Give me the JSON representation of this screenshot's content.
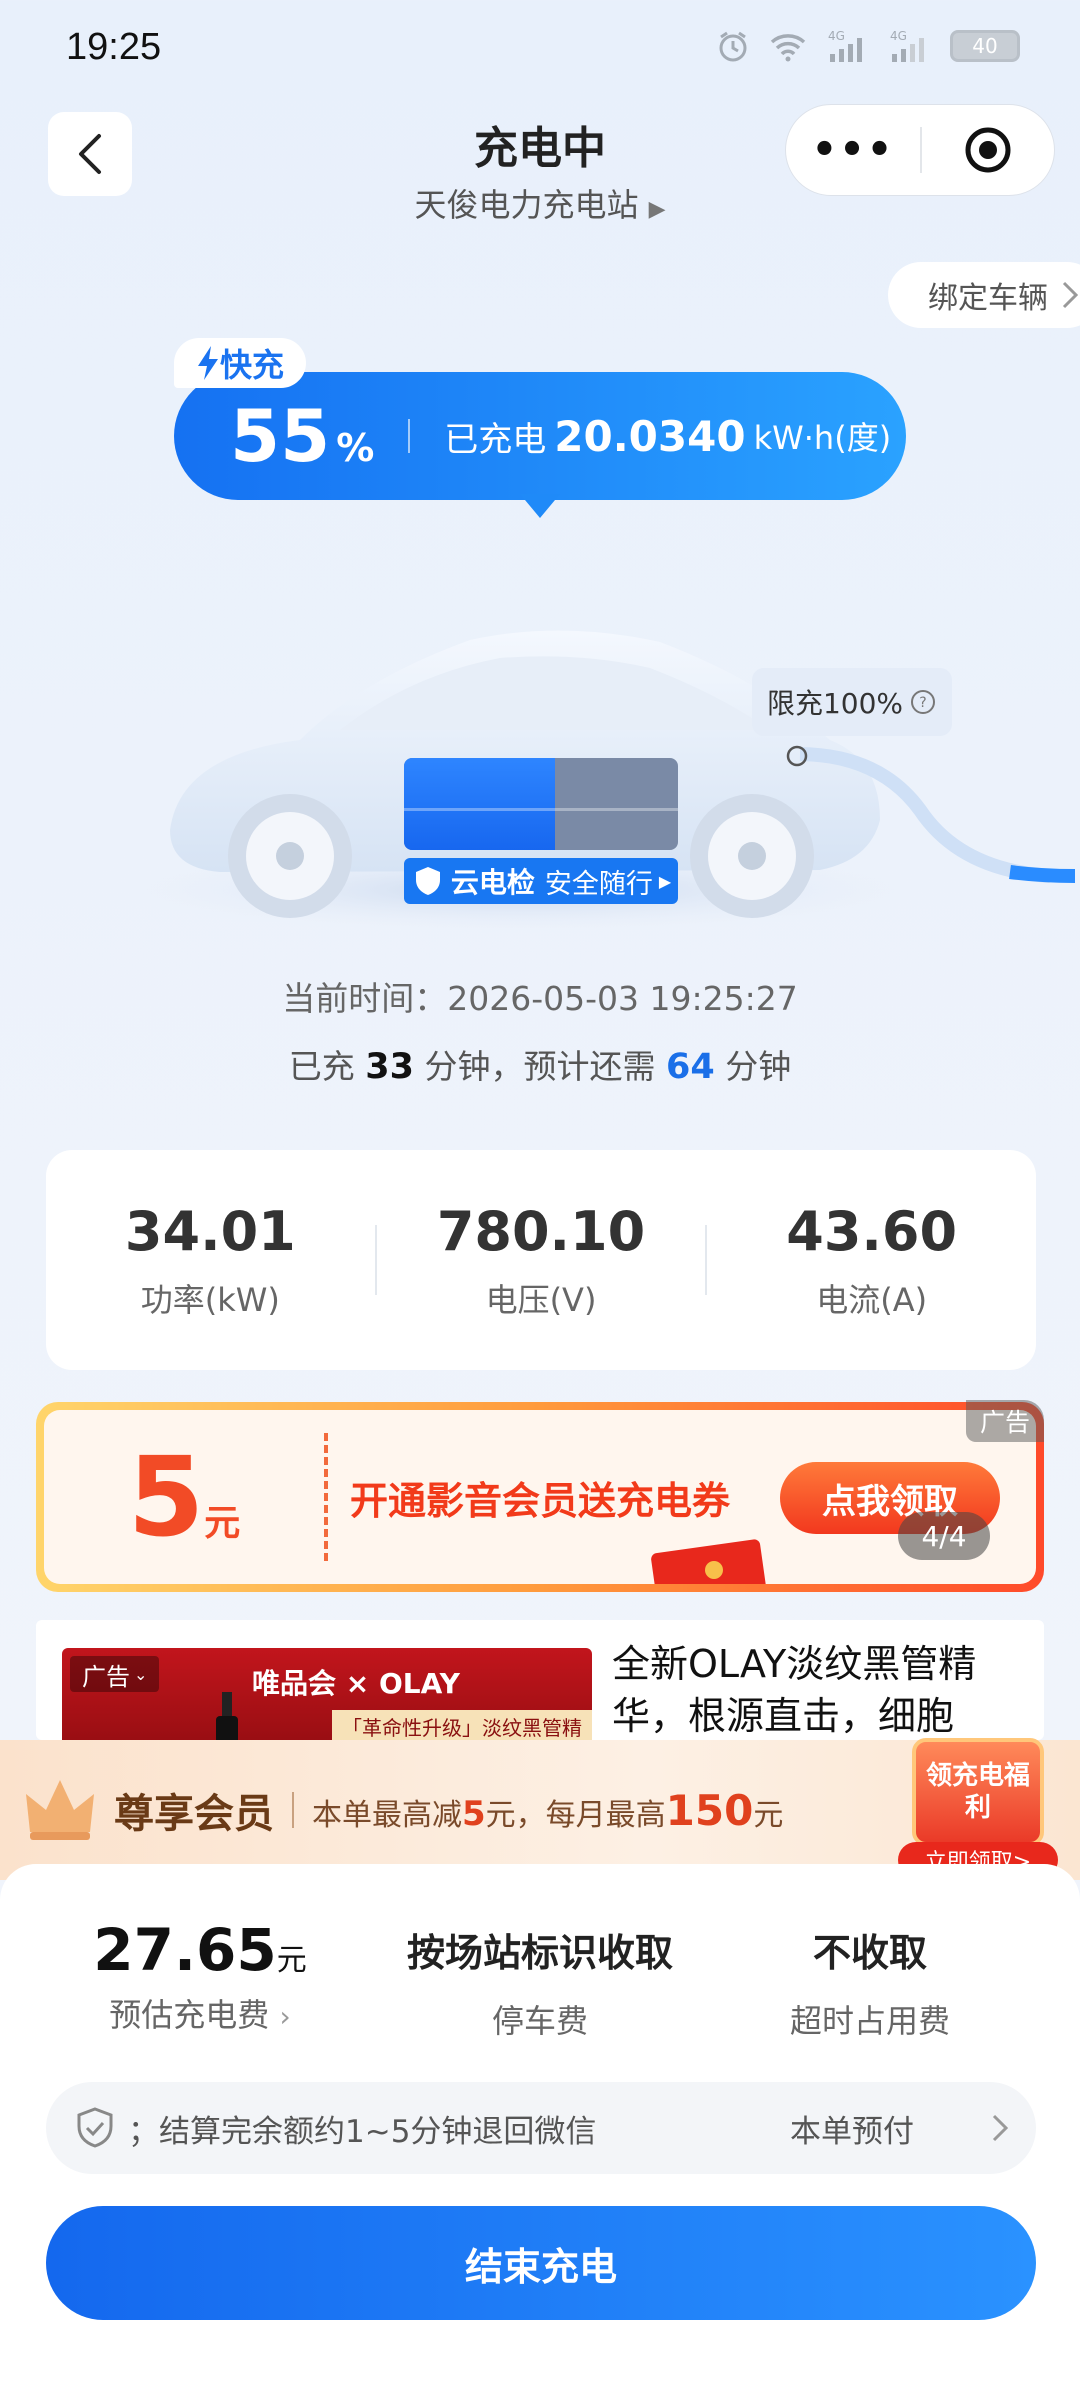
{
  "status_bar": {
    "time": "19:25",
    "battery": "40"
  },
  "header": {
    "title": "充电中",
    "station": "天俊电力充电站"
  },
  "bind_vehicle": "绑定车辆",
  "charge": {
    "mode": "快充",
    "percent": "55",
    "percent_sign": "%",
    "charged_label": "已充电",
    "energy": "20.0340",
    "energy_unit": "kW·h(度)",
    "percent_value": 55
  },
  "limit": "限充100%",
  "cloud_check": {
    "brand": "云电检",
    "slogan": "安全随行"
  },
  "current_time": "当前时间：2026-05-03 19:25:27",
  "elapsed": {
    "pre": "已充",
    "minutes": "33",
    "mid": "分钟，预计还需",
    "remaining": "64",
    "post": "分钟"
  },
  "metrics": [
    {
      "value": "34.01",
      "label": "功率(kW)"
    },
    {
      "value": "780.10",
      "label": "电压(V)"
    },
    {
      "value": "43.60",
      "label": "电流(A)"
    }
  ],
  "ad_banner": {
    "amount": "5",
    "unit": "元",
    "text": "开通影音会员送充电券",
    "button": "点我领取",
    "tag": "广告",
    "pager": "4/4"
  },
  "feed_ad": {
    "tag": "广告",
    "brand": "唯品会 × OLAY",
    "sub": "「革命性升级」淡纹黑管精华",
    "title": "全新OLAY淡纹黑管精华，根源直击，细胞"
  },
  "member": {
    "title": "尊享会员",
    "pre": "本单最高减",
    "amount1": "5",
    "mid": "元，每月最高",
    "amount2": "150",
    "post": "元",
    "gift_title": "领充电福利",
    "gift_btn": "立即领取>"
  },
  "fees": [
    {
      "value": "27.65",
      "unit": "元",
      "label": "预估充电费"
    },
    {
      "value": "按场站标识收取",
      "label": "停车费"
    },
    {
      "value": "不收取",
      "label": "超时占用费"
    }
  ],
  "notice": {
    "text": "；结算完余额约1~5分钟退回微信",
    "right": "本单预付"
  },
  "end_button": "结束充电"
}
